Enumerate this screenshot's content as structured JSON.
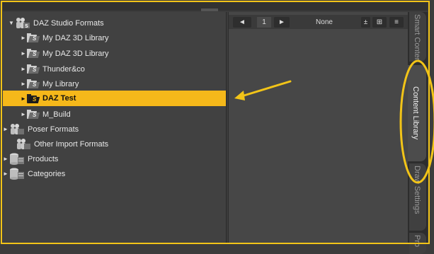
{
  "tree": {
    "items": [
      {
        "label": "DAZ Studio Formats",
        "arrow": "▼",
        "icon": "figure-icon"
      },
      {
        "label": "My DAZ 3D Library",
        "arrow": "►",
        "icon": "folder-icon"
      },
      {
        "label": "My DAZ 3D Library",
        "arrow": "►",
        "icon": "folder-icon"
      },
      {
        "label": "Thunder&co",
        "arrow": "►",
        "icon": "folder-icon"
      },
      {
        "label": "My Library",
        "arrow": "►",
        "icon": "folder-icon"
      },
      {
        "label": "DAZ Test",
        "arrow": "►",
        "icon": "folder-icon",
        "selected": true
      },
      {
        "label": "M_Build",
        "arrow": "►",
        "icon": "folder-icon"
      },
      {
        "label": "Poser Formats",
        "arrow": "►",
        "icon": "figure-icon"
      },
      {
        "label": "Other Import Formats",
        "arrow": "",
        "icon": "figure-icon"
      },
      {
        "label": "Products",
        "arrow": "►",
        "icon": "database-icon"
      },
      {
        "label": "Categories",
        "arrow": "►",
        "icon": "database-icon"
      }
    ]
  },
  "content": {
    "page_number": "1",
    "filter_label": "None",
    "prev_icon": "arrow-left-icon",
    "next_icon": "arrow-right-icon",
    "prev_glyph": "◄",
    "next_glyph": "►",
    "sort_glyph": "±",
    "grid_glyph": "⊞",
    "list_glyph": "≡"
  },
  "tabs": [
    {
      "label": "Smart Content",
      "active": false
    },
    {
      "label": "Content Library",
      "active": true
    },
    {
      "label": "Draw Settings",
      "active": false
    },
    {
      "label": "Pro",
      "active": false
    }
  ],
  "colors": {
    "selection": "#f5b81a",
    "annotation": "#f2c418",
    "panel": "#414141"
  }
}
